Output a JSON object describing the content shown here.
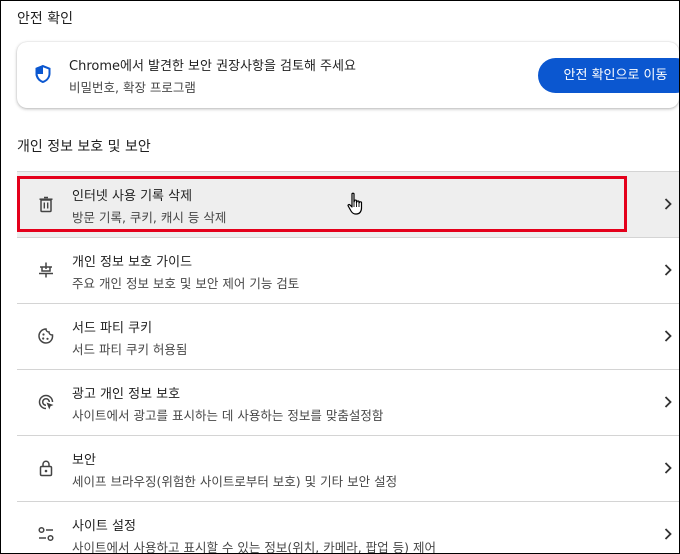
{
  "safety_check": {
    "section_title": "안전 확인",
    "card_title": "Chrome에서 발견한 보안 권장사항을 검토해 주세요",
    "card_subtitle": "비밀번호, 확장 프로그램",
    "button_label": "안전 확인으로 이동"
  },
  "privacy": {
    "section_title": "개인 정보 보호 및 보안",
    "items": [
      {
        "icon": "trash-icon",
        "label": "인터넷 사용 기록 삭제",
        "desc": "방문 기록, 쿠키, 캐시 등 삭제"
      },
      {
        "icon": "privacy-guide-icon",
        "label": "개인 정보 보호 가이드",
        "desc": "주요 개인 정보 보호 및 보안 제어 기능 검토"
      },
      {
        "icon": "cookie-icon",
        "label": "서드 파티 쿠키",
        "desc": "서드 파티 쿠키 허용됨"
      },
      {
        "icon": "ad-privacy-icon",
        "label": "광고 개인 정보 보호",
        "desc": "사이트에서 광고를 표시하는 데 사용하는 정보를 맞춤설정함"
      },
      {
        "icon": "lock-icon",
        "label": "보안",
        "desc": "세이프 브라우징(위험한 사이트로부터 보호) 및 기타 보안 설정"
      },
      {
        "icon": "tune-icon",
        "label": "사이트 설정",
        "desc": "사이트에서 사용하고 표시할 수 있는 정보(위치, 카메라, 팝업 등) 제어"
      }
    ]
  },
  "colors": {
    "accent": "#0b57d0",
    "highlight_box": "#e4001b",
    "row_hover": "#eeeeee"
  }
}
